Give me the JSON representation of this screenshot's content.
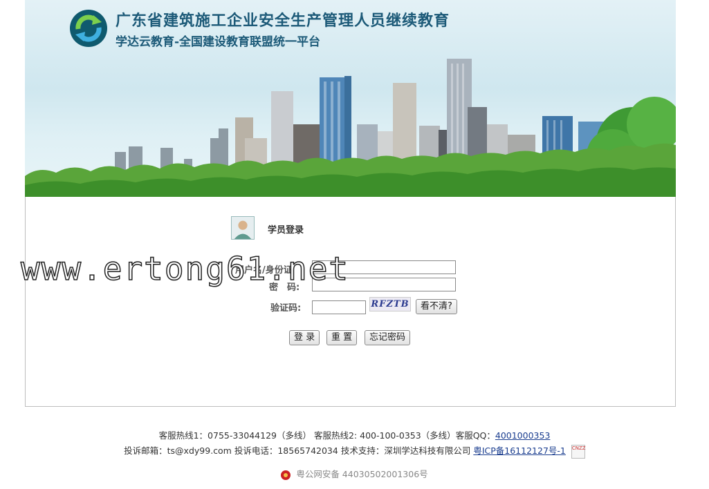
{
  "header": {
    "title": "广东省建筑施工企业安全生产管理人员继续教育",
    "subtitle": "学达云教育-全国建设教育联盟统一平台",
    "logo_icon": "circular-arrows-logo-icon"
  },
  "login": {
    "title": "学员登录",
    "username_label": "用户名/身份证",
    "password_label": "密　码:",
    "captcha_label": "验证码:",
    "captcha_text": "RFZTB",
    "refresh_captcha": "看不清?",
    "login_button": "登 录",
    "reset_button": "重 置",
    "forgot_button": "忘记密码",
    "username_value": "",
    "password_value": "",
    "captcha_value": ""
  },
  "watermark": "www.ertong61.net",
  "footer": {
    "hotline1": "客服热线1：0755-33044129（多线）",
    "hotline2": "客服热线2: 400-100-0353（多线）",
    "qq_label": "客服QQ：",
    "qq_number": "4001000353",
    "email": "投诉邮箱：ts@xdy99.com",
    "phone": "投诉电话：18565742034",
    "support": "技术支持：深圳学达科技有限公司",
    "icp": "粤ICP备16112127号-1",
    "cnzz_text": "CNZZ",
    "police": "粤公网安备 44030502001306号"
  },
  "colors": {
    "title": "#1c5a78",
    "link": "#1a3d8f",
    "grass": "#4f9a2f"
  }
}
